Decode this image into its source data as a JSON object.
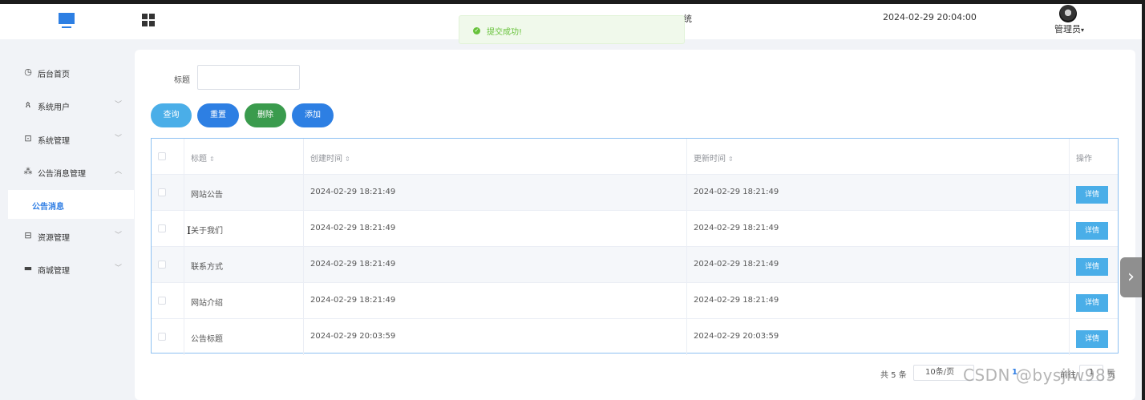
{
  "header": {
    "title_fragment": "统",
    "datetime": "2024-02-29 20:04:00",
    "admin_name": "管理员",
    "admin_caret": "▾"
  },
  "toast": {
    "message": "提交成功!",
    "icon": "check-circle-icon",
    "color": "#67c23a"
  },
  "sidebar": {
    "items": [
      {
        "label": "后台首页",
        "icon": "clock-icon",
        "arrow": ""
      },
      {
        "label": "系统用户",
        "icon": "user-icon",
        "arrow": "﹀"
      },
      {
        "label": "系统管理",
        "icon": "folder-icon",
        "arrow": "﹀"
      },
      {
        "label": "公告消息管理",
        "icon": "loading-icon",
        "arrow": "︿"
      },
      {
        "label": "资源管理",
        "icon": "resource-icon",
        "arrow": "﹀"
      },
      {
        "label": "商城管理",
        "icon": "monitor-icon",
        "arrow": "﹀"
      }
    ],
    "active_sub": "公告消息"
  },
  "search": {
    "label": "标题",
    "value": "",
    "placeholder": ""
  },
  "buttons": {
    "query": "查询",
    "reset": "重置",
    "delete": "删除",
    "add": "添加"
  },
  "table": {
    "headers": {
      "title": "标题",
      "created": "创建时间",
      "updated": "更新时间",
      "ops": "操作",
      "sort_glyph": "⇕"
    },
    "rows": [
      {
        "title": "网站公告",
        "created": "2024-02-29 18:21:49",
        "updated": "2024-02-29 18:21:49",
        "action": "详情"
      },
      {
        "title": "关于我们",
        "created": "2024-02-29 18:21:49",
        "updated": "2024-02-29 18:21:49",
        "action": "详情"
      },
      {
        "title": "联系方式",
        "created": "2024-02-29 18:21:49",
        "updated": "2024-02-29 18:21:49",
        "action": "详情"
      },
      {
        "title": "网站介绍",
        "created": "2024-02-29 18:21:49",
        "updated": "2024-02-29 18:21:49",
        "action": "详情"
      },
      {
        "title": "公告标题",
        "created": "2024-02-29 20:03:59",
        "updated": "2024-02-29 20:03:59",
        "action": "详情"
      }
    ]
  },
  "pager": {
    "total": "共 5 条",
    "size": "10条/页",
    "page": "1",
    "goto": "前往",
    "goto_value": "1",
    "unit": "页"
  },
  "watermark": "CSDN @bysjlw985",
  "colors": {
    "primary": "#2d7fe3",
    "query": "#4aaee8",
    "delete": "#3a9b4d",
    "active": "#2e7de4"
  }
}
